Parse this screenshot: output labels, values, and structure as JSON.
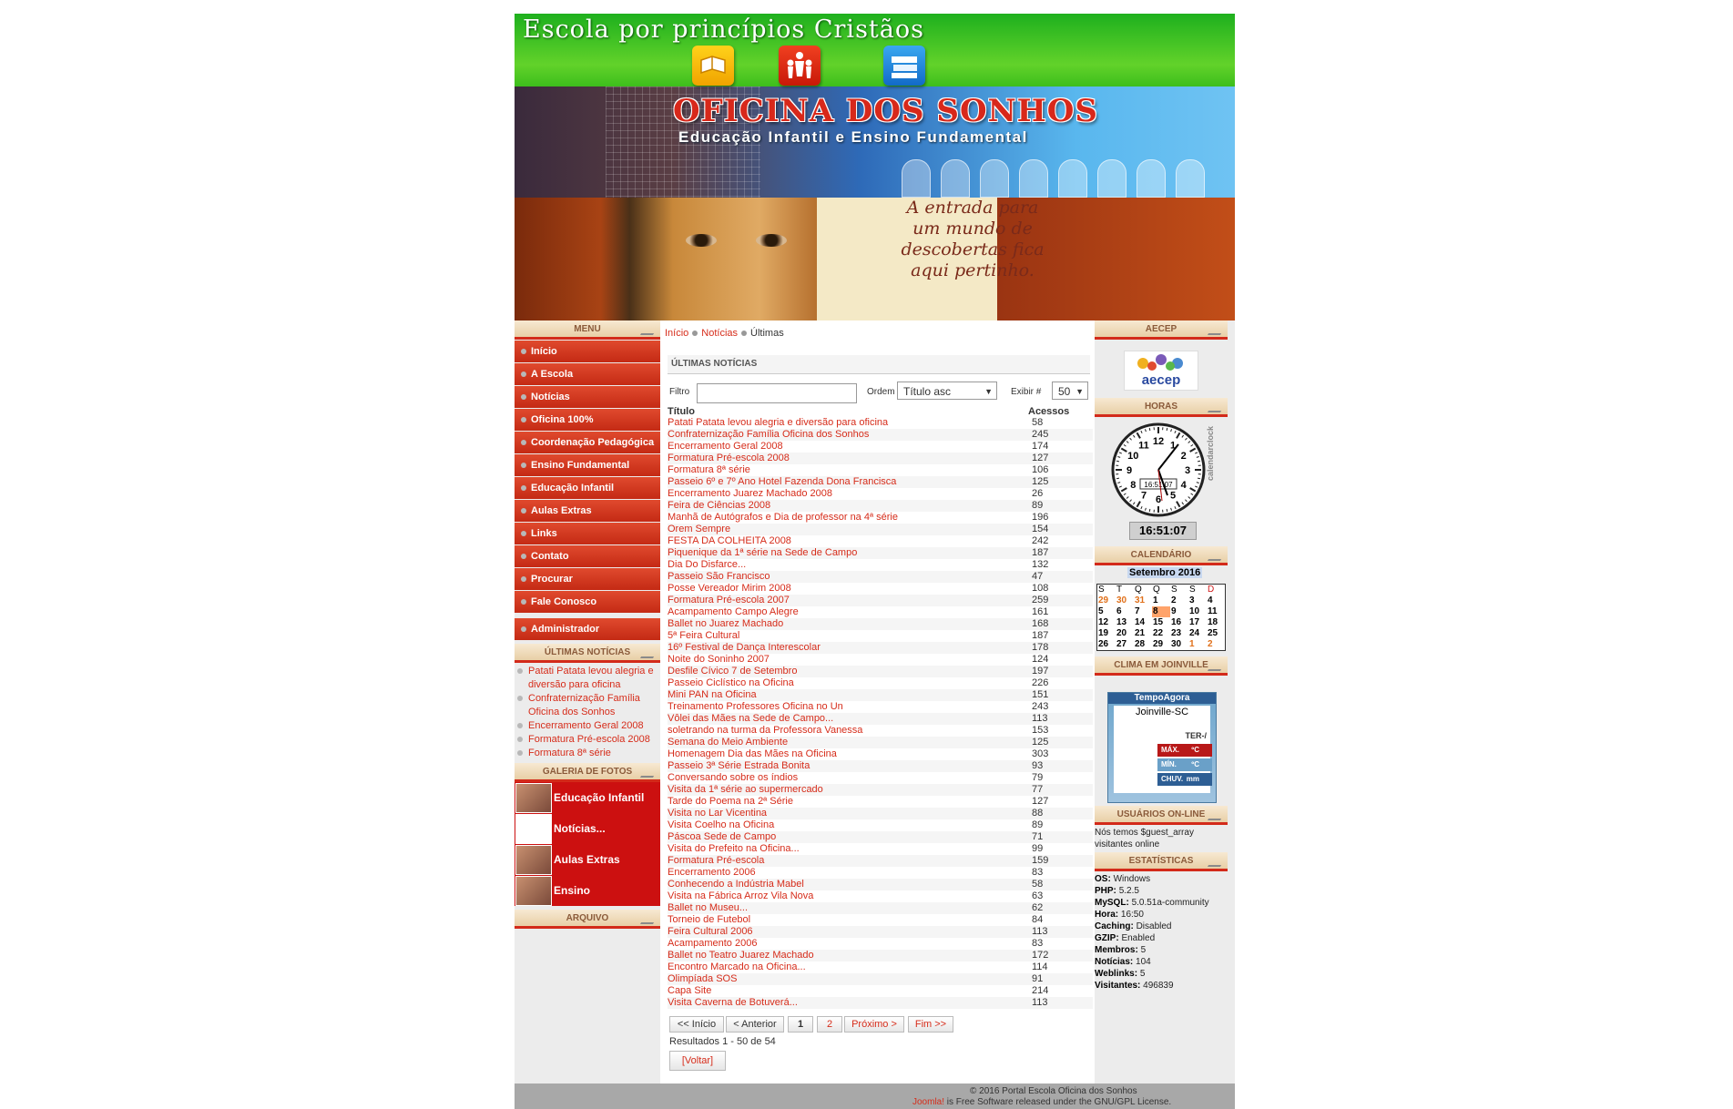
{
  "header": {
    "slogan": "Escola por princípios Cristãos",
    "title": "OFICINA DOS SONHOS",
    "subtitle": "Educação Infantil e Ensino Fundamental",
    "quote": "A entrada para um mundo de descobertas fica aqui pertinho."
  },
  "menu": {
    "title": "MENU",
    "items": [
      "Início",
      "A Escola",
      "Notícias",
      "Oficina 100%",
      "Coordenação Pedagógica",
      "Ensino Fundamental",
      "Educação Infantil",
      "Aulas Extras",
      "Links",
      "Contato",
      "Procurar",
      "Fale Conosco"
    ],
    "admin": "Administrador"
  },
  "latest": {
    "title": "ÚLTIMAS NOTÍCIAS",
    "items": [
      "Patati Patata levou alegria e diversão para oficina",
      "Confraternização Família Oficina dos Sonhos",
      "Encerramento Geral 2008",
      "Formatura Pré-escola 2008",
      "Formatura 8ª série"
    ]
  },
  "gallery": {
    "title": "GALERIA DE FOTOS",
    "items": [
      "Educação Infantil",
      "Notícias...",
      "Aulas Extras",
      "Ensino Fundamental"
    ]
  },
  "archive": {
    "title": "ARQUIVO"
  },
  "breadcrumb": {
    "home": "Início",
    "section": "Notícias",
    "current": "Últimas"
  },
  "category": {
    "title": "ÚLTIMAS NOTÍCIAS"
  },
  "filterbar": {
    "filter_label": "Filtro",
    "filter_value": "",
    "order_label": "Ordem",
    "order_value": "Título asc",
    "show_label": "Exibir #",
    "show_value": "50"
  },
  "table": {
    "col_title": "Título",
    "col_hits": "Acessos",
    "rows": [
      [
        "Patati Patata levou alegria e diversão para oficina",
        "58"
      ],
      [
        "Confraternização Família Oficina dos Sonhos",
        "245"
      ],
      [
        "Encerramento Geral 2008",
        "174"
      ],
      [
        "Formatura Pré-escola 2008",
        "127"
      ],
      [
        "Formatura 8ª série",
        "106"
      ],
      [
        "Passeio 6º e 7º Ano Hotel Fazenda Dona Francisca",
        "125"
      ],
      [
        "Encerramento Juarez Machado 2008",
        "26"
      ],
      [
        "Feira de Ciências 2008",
        "89"
      ],
      [
        "Manhã de Autógrafos e Dia de professor na 4ª série",
        "196"
      ],
      [
        "Orem Sempre",
        "154"
      ],
      [
        "FESTA DA COLHEITA 2008",
        "242"
      ],
      [
        "Piquenique da 1ª série na Sede de Campo",
        "187"
      ],
      [
        "Dia Do Disfarce...",
        "132"
      ],
      [
        "Passeio São Francisco",
        "47"
      ],
      [
        "Posse Vereador Mirim 2008",
        "108"
      ],
      [
        "Formatura Pré-escola 2007",
        "259"
      ],
      [
        "Acampamento Campo Alegre",
        "161"
      ],
      [
        "Ballet no Juarez Machado",
        "168"
      ],
      [
        "5ª Feira Cultural",
        "187"
      ],
      [
        "16º Festival de Dança Interescolar",
        "178"
      ],
      [
        "Noite do Soninho 2007",
        "124"
      ],
      [
        "Desfile Cívico 7 de Setembro",
        "197"
      ],
      [
        "Passeio Ciclístico na Oficina",
        "226"
      ],
      [
        "Mini PAN na Oficina",
        "151"
      ],
      [
        "Treinamento Professores Oficina no Un",
        "243"
      ],
      [
        "Vôlei das Mães na Sede de Campo...",
        "113"
      ],
      [
        "soletrando na turma da Professora Vanessa",
        "153"
      ],
      [
        "Semana do Meio Ambiente",
        "125"
      ],
      [
        "Homenagem Dia das Mães na Oficina",
        "303"
      ],
      [
        "Passeio 3ª Série Estrada Bonita",
        "93"
      ],
      [
        "Conversando sobre os índios",
        "79"
      ],
      [
        "Visita da 1ª série ao supermercado",
        "77"
      ],
      [
        "Tarde do Poema na 2ª Série",
        "127"
      ],
      [
        "Visita no Lar Vicentina",
        "88"
      ],
      [
        "Visita Coelho na Oficina",
        "89"
      ],
      [
        "Páscoa Sede de Campo",
        "71"
      ],
      [
        "Visita do Prefeito na Oficina...",
        "99"
      ],
      [
        "Formatura Pré-escola",
        "159"
      ],
      [
        "Encerramento 2006",
        "83"
      ],
      [
        "Conhecendo a Indústria Mabel",
        "58"
      ],
      [
        "Visita na Fábrica Arroz Vila Nova",
        "63"
      ],
      [
        "Ballet no Museu...",
        "62"
      ],
      [
        "Torneio de Futebol",
        "84"
      ],
      [
        "Feira Cultural 2006",
        "113"
      ],
      [
        "Acampamento 2006",
        "83"
      ],
      [
        "Ballet no Teatro Juarez Machado",
        "172"
      ],
      [
        "Encontro Marcado na Oficina...",
        "114"
      ],
      [
        "Olimpíada SOS",
        "91"
      ],
      [
        "Capa Site",
        "214"
      ],
      [
        "Visita Caverna de Botuverá...",
        "113"
      ]
    ]
  },
  "pager": {
    "first": "<< Início",
    "prev": "< Anterior",
    "p1": "1",
    "p2": "2",
    "next": "Próximo >",
    "last": "Fim >>",
    "results": "Resultados 1 - 50 de 54",
    "back": "[Voltar]"
  },
  "right": {
    "aecep_title": "AECEP",
    "aecep_logo": "aecep",
    "hours_title": "HORAS",
    "clock_inner": "16:51:07",
    "clock_brand": "calendarclock",
    "clock_time": "16:51:07",
    "calendar_title": "CALENDÁRIO",
    "calendar_month": "Setembro 2016",
    "calendar_days": [
      "S",
      "T",
      "Q",
      "Q",
      "S",
      "S",
      "D"
    ],
    "calendar_cells": [
      "29",
      "30",
      "31",
      "1",
      "2",
      "3",
      "4",
      "5",
      "6",
      "7",
      "8",
      "9",
      "10",
      "11",
      "12",
      "13",
      "14",
      "15",
      "16",
      "17",
      "18",
      "19",
      "20",
      "21",
      "22",
      "23",
      "24",
      "25",
      "26",
      "27",
      "28",
      "29",
      "30",
      "1",
      "2"
    ],
    "weather_title": "CLIMA EM JOINVILLE",
    "weather_brand": "TempoAgora",
    "weather_city": "Joinville-SC",
    "weather_day": "TER-/",
    "weather_max": "MÁX.",
    "weather_max_unit": "ºC",
    "weather_min": "MÍN.",
    "weather_min_unit": "ºC",
    "weather_rain": "CHUV.",
    "weather_rain_unit": "mm",
    "online_title": "USUÁRIOS ON-LINE",
    "online_text": "Nós temos $guest_array visitantes online",
    "stats_title": "ESTATÍSTICAS",
    "stats": [
      {
        "k": "OS:",
        "v": "Windows"
      },
      {
        "k": "PHP:",
        "v": "5.2.5"
      },
      {
        "k": "MySQL:",
        "v": "5.0.51a-community"
      },
      {
        "k": "Hora:",
        "v": "16:50"
      },
      {
        "k": "Caching:",
        "v": "Disabled"
      },
      {
        "k": "GZIP:",
        "v": "Enabled"
      },
      {
        "k": "Membros:",
        "v": "5"
      },
      {
        "k": "Notícias:",
        "v": "104"
      },
      {
        "k": "Weblinks:",
        "v": "5"
      },
      {
        "k": "Visitantes:",
        "v": "496839"
      }
    ]
  },
  "footer": {
    "copyright": "© 2016 Portal Escola Oficina dos Sonhos",
    "joomla": "Joomla!",
    "license": " is Free Software released under the GNU/GPL License."
  },
  "colors": {
    "accent": "#d62c1a",
    "menu": "#cc2c18",
    "header_green": "#2fb82a",
    "footer": "#a8a8a8"
  }
}
